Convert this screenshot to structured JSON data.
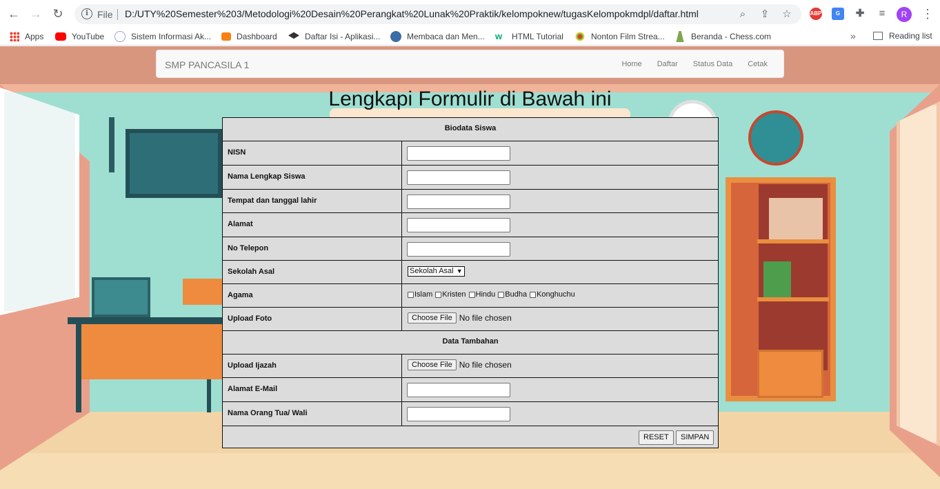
{
  "browser": {
    "scheme_label": "File",
    "url": "D:/UTY%20Semester%203/Metodologi%20Desain%20Perangkat%20Lunak%20Praktik/kelompoknew/tugasKelompokmdpl/daftar.html",
    "avatar_letter": "R",
    "abp_label": "ABP",
    "bookmarks": [
      "Apps",
      "YouTube",
      "Sistem Informasi Ak...",
      "Dashboard",
      "Daftar Isi - Aplikasi...",
      "Membaca dan Men...",
      "HTML Tutorial",
      "Nonton Film Strea...",
      "Beranda - Chess.com"
    ],
    "more_label": "»",
    "reading_list": "Reading list"
  },
  "navbar": {
    "brand": "SMP PANCASILA 1",
    "links": [
      "Home",
      "Daftar",
      "Status Data",
      "Cetak"
    ]
  },
  "heading": "Lengkapi Formulir di Bawah ini",
  "form": {
    "section1": "Biodata Siswa",
    "nisn": {
      "label": "NISN",
      "value": ""
    },
    "nama": {
      "label": "Nama Lengkap Siswa",
      "value": ""
    },
    "ttl": {
      "label": "Tempat dan tanggal lahir",
      "value": ""
    },
    "alamat": {
      "label": "Alamat",
      "value": ""
    },
    "telepon": {
      "label": "No Telepon",
      "value": ""
    },
    "sekolah": {
      "label": "Sekolah Asal",
      "selected": "Sekolah Asal"
    },
    "agama": {
      "label": "Agama",
      "options": [
        "Islam",
        "Kristen",
        "Hindu",
        "Budha",
        "Konghuchu"
      ]
    },
    "foto": {
      "label": "Upload Foto",
      "button": "Choose File",
      "status": "No file chosen"
    },
    "section2": "Data Tambahan",
    "ijazah": {
      "label": "Upload Ijazah",
      "button": "Choose File",
      "status": "No file chosen"
    },
    "email": {
      "label": "Alamat E-Mail",
      "value": ""
    },
    "ortu": {
      "label": "Nama Orang Tua/ Wali",
      "value": ""
    },
    "reset": "RESET",
    "simpan": "SIMPAN"
  }
}
